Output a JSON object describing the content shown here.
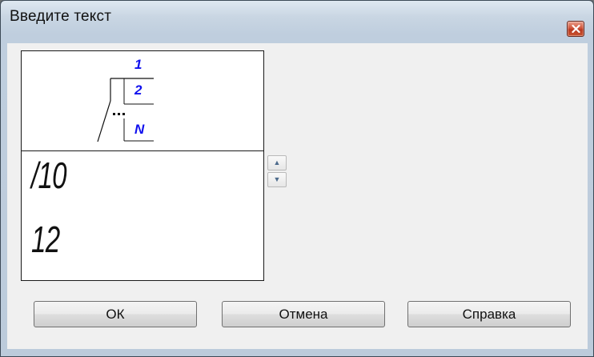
{
  "window": {
    "title": "Введите текст",
    "close_icon": "close-x-icon"
  },
  "symbol": {
    "labels": [
      "1",
      "2",
      "N"
    ],
    "label_color": "#1010ee"
  },
  "text_lines": [
    "/10",
    "12"
  ],
  "spin": {
    "up_icon": "arrow-up-icon",
    "down_icon": "arrow-down-icon",
    "up_glyph": "▲",
    "down_glyph": "▼"
  },
  "buttons": {
    "ok": "ОК",
    "cancel": "Отмена",
    "help": "Справка"
  }
}
